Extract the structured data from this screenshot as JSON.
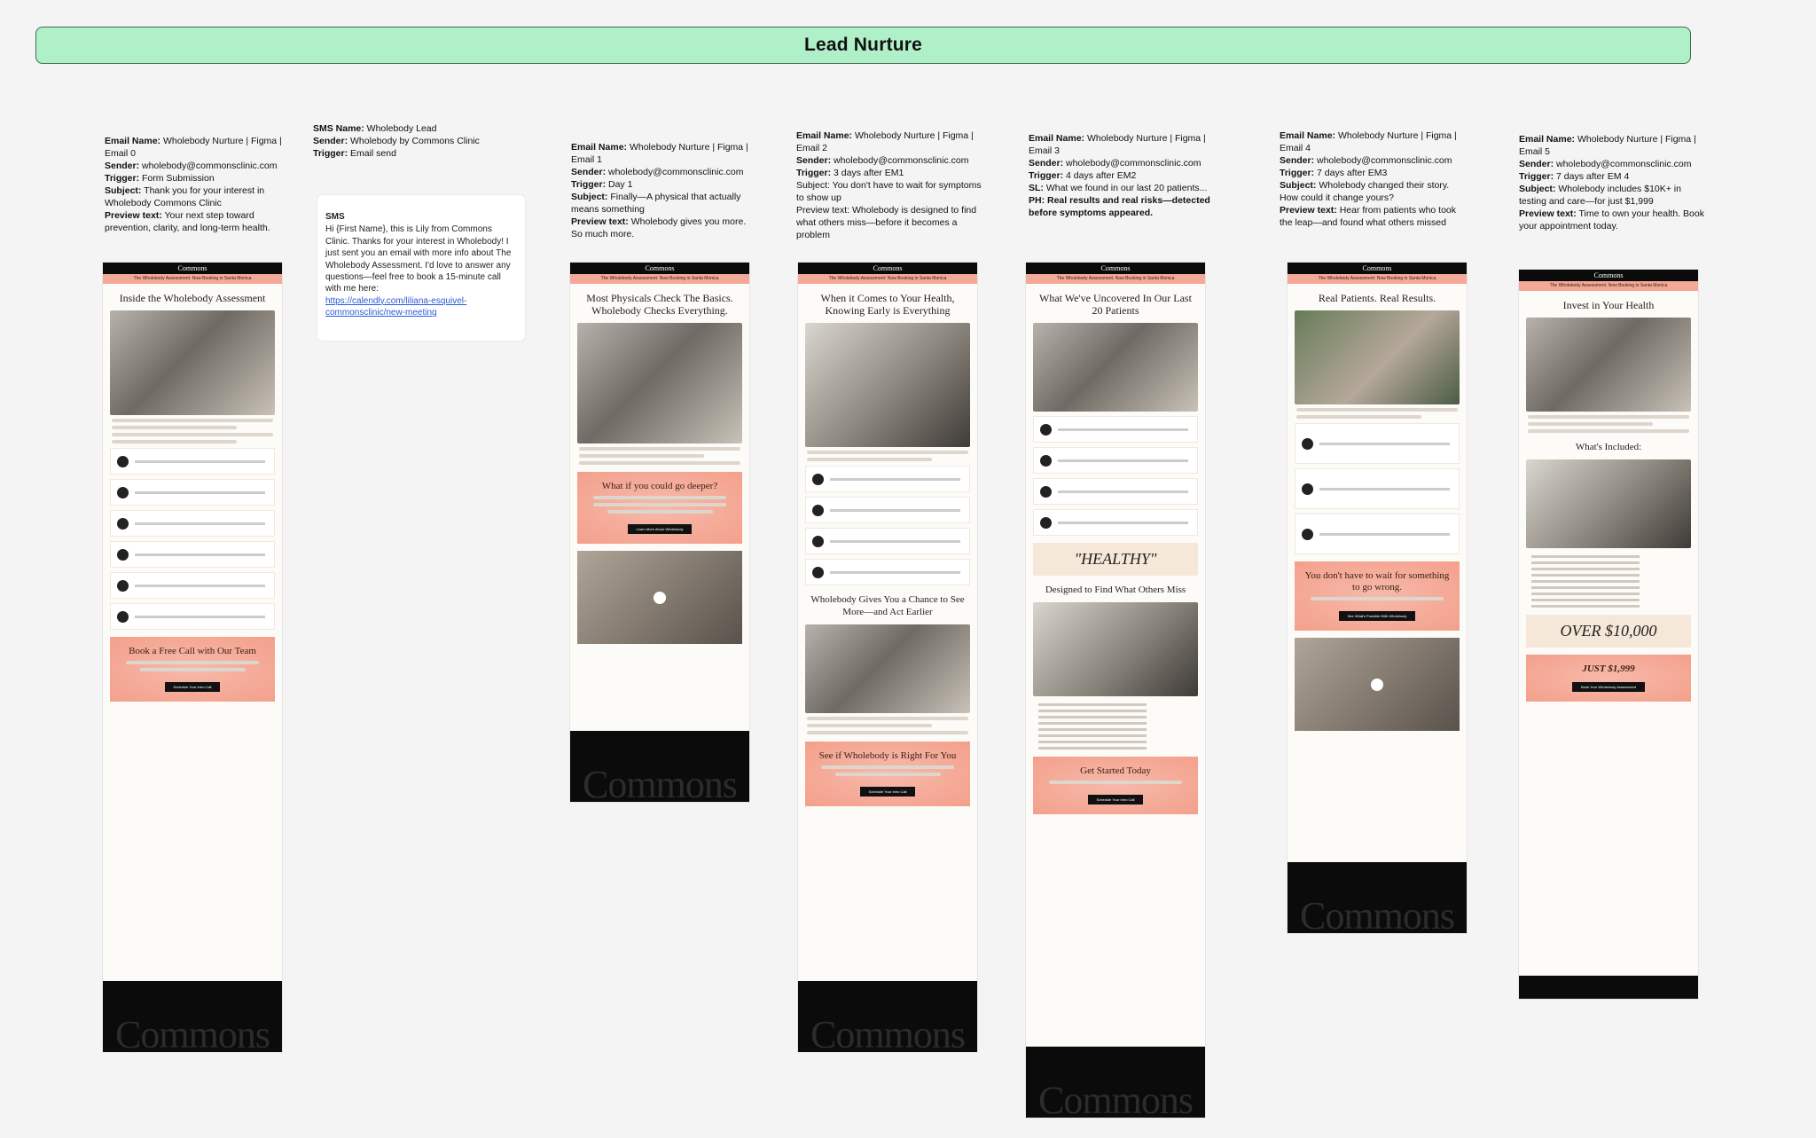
{
  "banner": {
    "title": "Lead Nurture"
  },
  "meta": {
    "email0": [
      {
        "label": "Email Name:",
        "value": " Wholebody Nurture | Figma | Email 0"
      },
      {
        "label": "Sender:",
        "value": " wholebody@commonsclinic.com"
      },
      {
        "label": "Trigger:",
        "value": " Form Submission"
      },
      {
        "label": "Subject:",
        "value": " Thank you for your interest in Wholebody Commons Clinic"
      },
      {
        "label": "Preview text:",
        "value": " Your next step toward prevention, clarity, and long-term health."
      }
    ],
    "sms": [
      {
        "label": "SMS Name:",
        "value": " Wholebody Lead"
      },
      {
        "label": "Sender:",
        "value": " Wholebody by Commons Clinic"
      },
      {
        "label": "Trigger:",
        "value": " Email send"
      }
    ],
    "email1": [
      {
        "label": "Email Name:",
        "value": " Wholebody Nurture | Figma | Email 1"
      },
      {
        "label": "Sender:",
        "value": " wholebody@commonsclinic.com"
      },
      {
        "label": "Trigger:",
        "value": " Day 1"
      },
      {
        "label": "Subject:",
        "value": " Finally—A physical that actually means something"
      },
      {
        "label": "Preview text:",
        "value": " Wholebody gives you more. So much more."
      }
    ],
    "email2": [
      {
        "label": "Email Name:",
        "value": " Wholebody Nurture | Figma | Email 2"
      },
      {
        "label": "Sender:",
        "value": " wholebody@commonsclinic.com"
      },
      {
        "label": "Trigger:",
        "value": " 3 days after EM1"
      },
      {
        "label": "",
        "value": "Subject: You don't have to wait for symptoms to show up"
      },
      {
        "label": "",
        "value": "Preview text: Wholebody is designed to find what others miss—before it becomes a problem"
      }
    ],
    "email3": [
      {
        "label": "Email Name:",
        "value": " Wholebody Nurture | Figma | Email 3"
      },
      {
        "label": "Sender:",
        "value": " wholebody@commonsclinic.com"
      },
      {
        "label": "Trigger:",
        "value": " 4 days after EM2"
      },
      {
        "label": "SL:",
        "value": " What we found in our last 20 patients..."
      },
      {
        "label": "PH: Real results and real risks—detected before symptoms appeared.",
        "value": ""
      }
    ],
    "email4": [
      {
        "label": "Email Name:",
        "value": " Wholebody Nurture | Figma | Email 4"
      },
      {
        "label": "Sender:",
        "value": " wholebody@commonsclinic.com"
      },
      {
        "label": "Trigger:",
        "value": " 7 days after EM3"
      },
      {
        "label": "Subject:",
        "value": " Wholebody changed their story. How could it change yours?"
      },
      {
        "label": "Preview text:",
        "value": " Hear from patients who took the leap—and found what others missed"
      }
    ],
    "email5": [
      {
        "label": "Email Name:",
        "value": " Wholebody Nurture | Figma | Email 5"
      },
      {
        "label": "Sender:",
        "value": " wholebody@commonsclinic.com"
      },
      {
        "label": "Trigger:",
        "value": " 7 days after EM 4"
      },
      {
        "label": "Subject:",
        "value": " Wholebody includes $10K+ in testing and care—for just $1,999"
      },
      {
        "label": "Preview text:",
        "value": " Time to own your health. Book your appointment today."
      }
    ]
  },
  "sms_card": {
    "title": "SMS",
    "body": "Hi {First Name}, this is Lily from Commons Clinic. Thanks for your interest in Wholebody! I just sent you an email with more info about The Wholebody Assessment. I'd love to answer any questions—feel free to book a 15-minute call with me here:",
    "link": "https://calendly.com/liliana-esquivel-commonsclinic/new-meeting"
  },
  "emails": [
    {
      "logo": "Commons",
      "bar": "The Wholebody Assessment: Now Booking in Santa Monica",
      "headline": "Inside the Wholebody Assessment",
      "cta_title": "Book a Free Call with Our Team",
      "button": "Schedule Your Intro Call"
    },
    {
      "logo": "Commons",
      "bar": "The Wholebody Assessment: Now Booking in Santa Monica",
      "headline": "Most Physicals Check The Basics. Wholebody Checks Everything.",
      "cta_title": "What if you could go deeper?",
      "button": "Learn More About Wholebody",
      "video": "The Wholebody Assessment"
    },
    {
      "logo": "Commons",
      "bar": "The Wholebody Assessment: Now Booking in Santa Monica",
      "headline": "When it Comes to Your Health, Knowing Early is Everything",
      "sub": "Wholebody Gives You a Chance to See More—and Act Earlier",
      "cta_title": "See if Wholebody is Right For You",
      "button": "Schedule Your Intro Call"
    },
    {
      "logo": "Commons",
      "bar": "The Wholebody Assessment: Now Booking in Santa Monica",
      "headline": "What We've Uncovered In Our Last 20 Patients",
      "healthy": "\"HEALTHY\"",
      "sub": "Designed to Find What Others Miss",
      "cta_title": "Get Started Today",
      "button": "Schedule Your Intro Call"
    },
    {
      "logo": "Commons",
      "bar": "The Wholebody Assessment: Now Booking in Santa Monica",
      "headline": "Real Patients. Real Results.",
      "cta_title": "You don't have to wait for something to go wrong.",
      "button": "See What's Possible With Wholebody",
      "video": "The Wholebody Assessment"
    },
    {
      "logo": "Commons",
      "bar": "The Wholebody Assessment: Now Booking in Santa Monica",
      "headline": "Invest in Your Health",
      "sub": "What's Included:",
      "offer": "OVER $10,000",
      "price": "JUST $1,999",
      "button": "Book Your Wholebody Assessment"
    }
  ],
  "footer_wordmark": "Commons"
}
